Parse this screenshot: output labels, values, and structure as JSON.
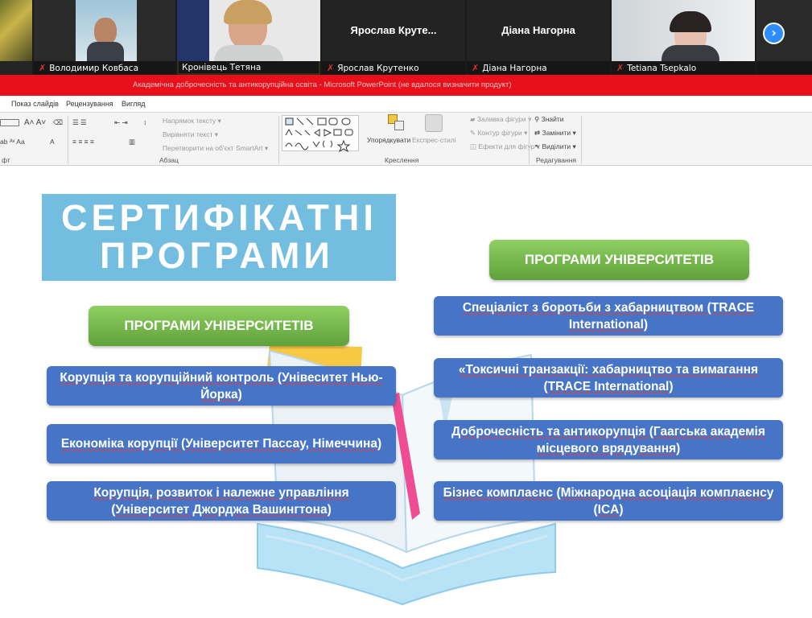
{
  "participants": [
    {
      "name": "",
      "muted": false
    },
    {
      "name": "Володимир Ковбаса",
      "muted": true
    },
    {
      "name": "Кронівець Тетяна",
      "muted": false
    },
    {
      "name": "Ярослав Крутенко",
      "muted": true,
      "center_label": "Ярослав  Круте..."
    },
    {
      "name": "Діана Нагорна",
      "muted": true,
      "center_label": "Діана Нагорна"
    },
    {
      "name": "Tetiana Tsepkalo",
      "muted": true
    }
  ],
  "next_page_icon": "chevron-right-icon",
  "window_title": "Академічна доброчесність та антикорупційна освіта - Microsoft PowerPoint (не вдалося визначити продукт)",
  "ribbon": {
    "tabs": [
      "Показ слайдів",
      "Рецензування",
      "Вигляд"
    ],
    "paragraph": {
      "text_direction": "Напрямок тексту",
      "align_text": "Вирівняти текст",
      "convert_smartart": "Перетворити на об'єкт SmartArt",
      "label": "Абзац"
    },
    "drawing": {
      "arrange": "Упорядкувати",
      "quick_styles": "Експрес-стилі",
      "shape_fill": "Заливка фігури",
      "shape_outline": "Контур фігури",
      "shape_effects": "Ефекти для фігур",
      "label": "Креслення"
    },
    "editing": {
      "find": "Знайти",
      "replace": "Замінити",
      "select": "Виділити",
      "label": "Редагування"
    },
    "font_label_fragment": "фт"
  },
  "slide": {
    "title_line1": "СЕРТИФІКАТНІ",
    "title_line2": "ПРОГРАМИ",
    "left": {
      "header": "ПРОГРАМИ УНІВЕРСИТЕТІВ",
      "items": [
        "Корупція та корупційний контроль (Унівеситет Нью-Йорка)",
        "Економіка корупції (Університет Пассау, Німеччина)",
        "Корупція, розвиток і належне управління (Університет Джорджа Вашингтона)"
      ]
    },
    "right": {
      "header": "ПРОГРАМИ УНІВЕРСИТЕТІВ",
      "items": [
        "Спеціаліст з боротьби з хабарництвом (TRACE International)",
        "«Токсичні транзакції: хабарництво та вимагання (TRACE International)",
        "Доброчесність та антикорупція (Гаагська академія місцевого врядування)",
        "Бізнес комплаєнс (Міжнародна асоціація комплаєнсу (ICA)"
      ]
    }
  },
  "colors": {
    "title_bar": "#e8101a",
    "cert_title_bg": "#72bde0",
    "green": "#6cb046",
    "blue": "#4674c6",
    "zoom_blue": "#2d8cff"
  }
}
